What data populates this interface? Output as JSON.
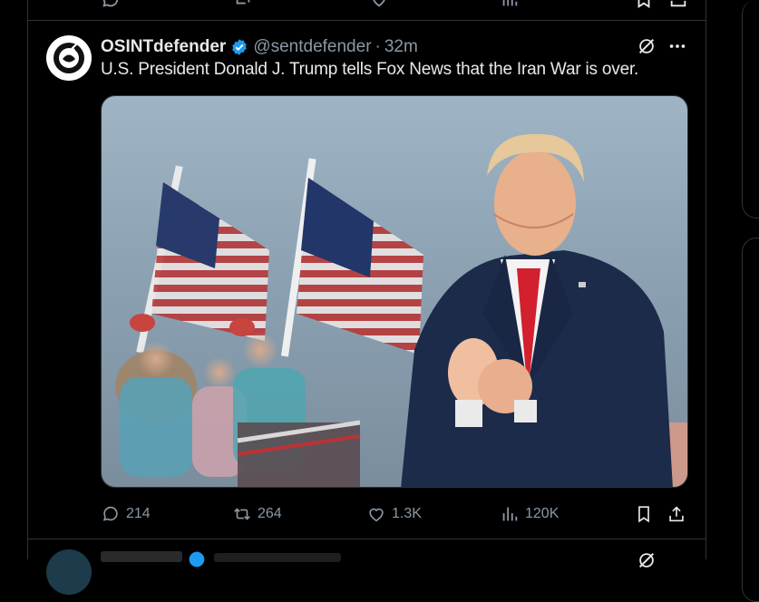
{
  "tweet": {
    "author_name": "OSINTdefender",
    "handle": "@sentdefender",
    "separator": "·",
    "time": "32m",
    "text": "U.S. President Donald J. Trump tells Fox News that the Iran War is over.",
    "verified_color": "#1d9bf0"
  },
  "actions": {
    "replies": "214",
    "reposts": "264",
    "likes": "1.3K",
    "views": "120K"
  },
  "icons": {
    "reply": "reply-icon",
    "repost": "repost-icon",
    "like": "heart-icon",
    "views": "views-icon",
    "bookmark": "bookmark-icon",
    "share": "share-icon",
    "grok": "grok-icon",
    "more": "more-icon"
  },
  "colors": {
    "background": "#000000",
    "text": "#e7e9ea",
    "secondary": "#8b98a5",
    "border": "#2f3336",
    "accent": "#1d9bf0"
  }
}
